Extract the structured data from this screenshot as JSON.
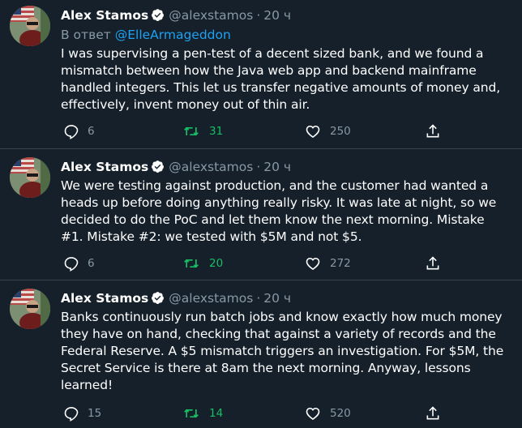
{
  "colors": {
    "background": "#15202b",
    "text": "#ffffff",
    "muted": "#8899a6",
    "link": "#1da1f2",
    "retweet": "#17bf63",
    "divider": "#38444d"
  },
  "tweets": [
    {
      "author_name": "Alex Stamos",
      "handle": "@alexstamos",
      "separator": "·",
      "time": "20 ч",
      "reply_prefix": "В ответ",
      "reply_to": "@ElleArmageddon",
      "text": "I was supervising a pen-test of a decent sized bank, and we found a mismatch between how the Java web app and backend mainframe handled integers. This let us transfer negative amounts of money and, effectively, invent money out of thin air.",
      "replies": "6",
      "retweets": "31",
      "likes": "250"
    },
    {
      "author_name": "Alex Stamos",
      "handle": "@alexstamos",
      "separator": "·",
      "time": "20 ч",
      "text": "We were testing against production, and the customer had wanted a heads up before doing anything really risky. It was late at night, so we decided to do the PoC and let them know the next morning. Mistake #1. Mistake #2: we tested with $5M and not $5.",
      "replies": "6",
      "retweets": "20",
      "likes": "272"
    },
    {
      "author_name": "Alex Stamos",
      "handle": "@alexstamos",
      "separator": "·",
      "time": "20 ч",
      "text": "Banks continuously run batch jobs and know exactly how much money they have on hand, checking that against a variety of records and the Federal Reserve. A $5 mismatch triggers an investigation. For $5M, the Secret Service is there at 8am the next morning. Anyway, lessons learned!",
      "replies": "15",
      "retweets": "14",
      "likes": "520"
    }
  ]
}
